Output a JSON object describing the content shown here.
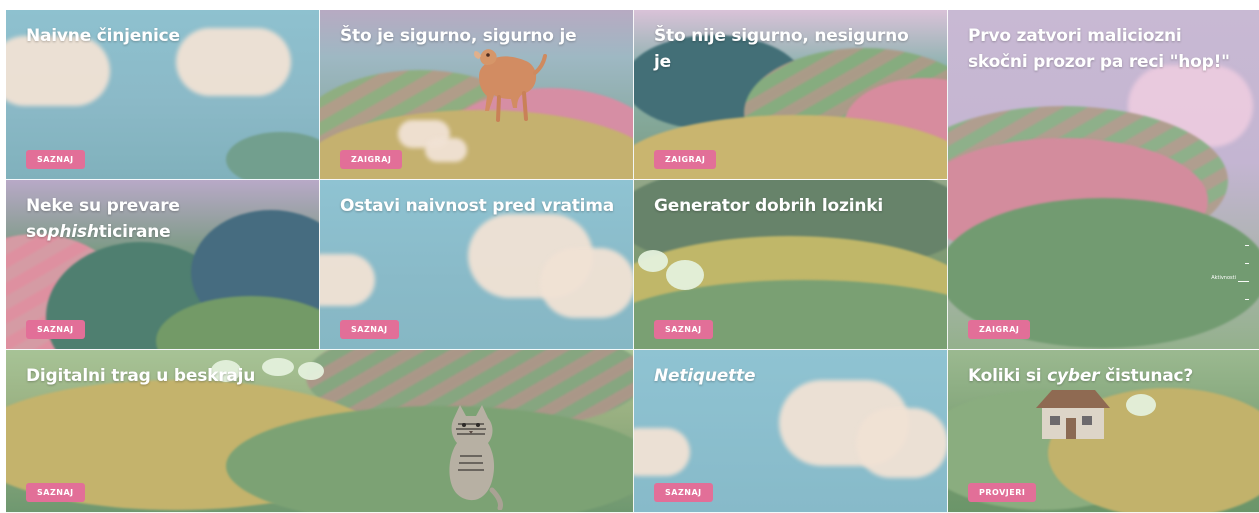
{
  "tiles": [
    {
      "title": "Naivne činjenice",
      "button": "SAZNAJ"
    },
    {
      "title": "Što je sigurno, sigurno je",
      "button": "ZAIGRAJ"
    },
    {
      "title": "Što nije sigurno, nesigurno je",
      "button": "ZAIGRAJ"
    },
    {
      "title_line1": "Prvo zatvori maliciozni",
      "title_line2": "skočni prozor pa reci \"hop!\"",
      "button": "ZAIGRAJ"
    },
    {
      "title_line1": "Neke su prevare",
      "title_line2_a": "so",
      "title_line2_b": "phish",
      "title_line2_c": "ticirane",
      "button": "SAZNAJ"
    },
    {
      "title": "Ostavi naivnost pred vratima",
      "button": "SAZNAJ"
    },
    {
      "title": "Generator dobrih lozinki",
      "button": "SAZNAJ"
    },
    {
      "title": "Digitalni trag u beskraju",
      "button": "SAZNAJ"
    },
    {
      "title": "Netiquette",
      "button": "SAZNAJ"
    },
    {
      "title_a": "Koliki si ",
      "title_b": "cyber",
      "title_c": " čistunac?",
      "button": "PROVJERI"
    }
  ],
  "indicator": {
    "label": "Aktivnosti"
  },
  "colors": {
    "button_pink": "#e26f98",
    "sky_blue": "#7fb4c6",
    "hill_green": "#6f9a72",
    "hill_pink": "#d78aa0",
    "hill_yellow": "#c9ba76",
    "lavender": "#c8b9d3"
  },
  "icons": {
    "tile_2": "dog-illustration",
    "tile_8": "cat-illustration",
    "tile_10": "house-illustration"
  }
}
